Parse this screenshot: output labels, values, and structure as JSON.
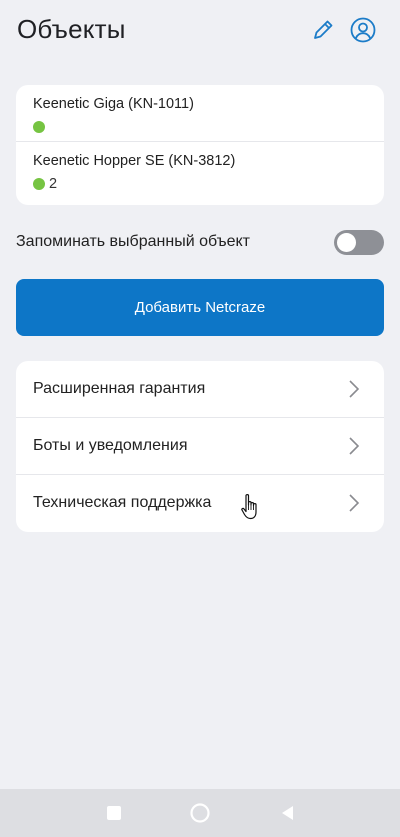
{
  "header": {
    "title": "Объекты",
    "edit_icon": "pencil-icon",
    "account_icon": "account-circle-icon"
  },
  "devices": [
    {
      "name": "Keenetic Giga (KN-1011)",
      "status_color": "#76c442",
      "count": ""
    },
    {
      "name": "Keenetic Hopper SE (KN-3812)",
      "status_color": "#76c442",
      "count": "2"
    }
  ],
  "remember": {
    "label": "Запоминать выбранный объект",
    "enabled": false
  },
  "add_button": {
    "label": "Добавить Netcraze"
  },
  "menu": [
    {
      "label": "Расширенная гарантия",
      "icon": "chevron-right-icon"
    },
    {
      "label": "Боты и уведомления",
      "icon": "chevron-right-icon"
    },
    {
      "label": "Техническая поддержка",
      "icon": "chevron-right-icon"
    }
  ],
  "navbar": {
    "recent_icon": "square-icon",
    "home_icon": "circle-icon",
    "back_icon": "triangle-back-icon"
  },
  "colors": {
    "accent": "#0d76c7",
    "status_online": "#76c442",
    "background": "#eff0f4",
    "toggle_off": "#8e9096"
  }
}
